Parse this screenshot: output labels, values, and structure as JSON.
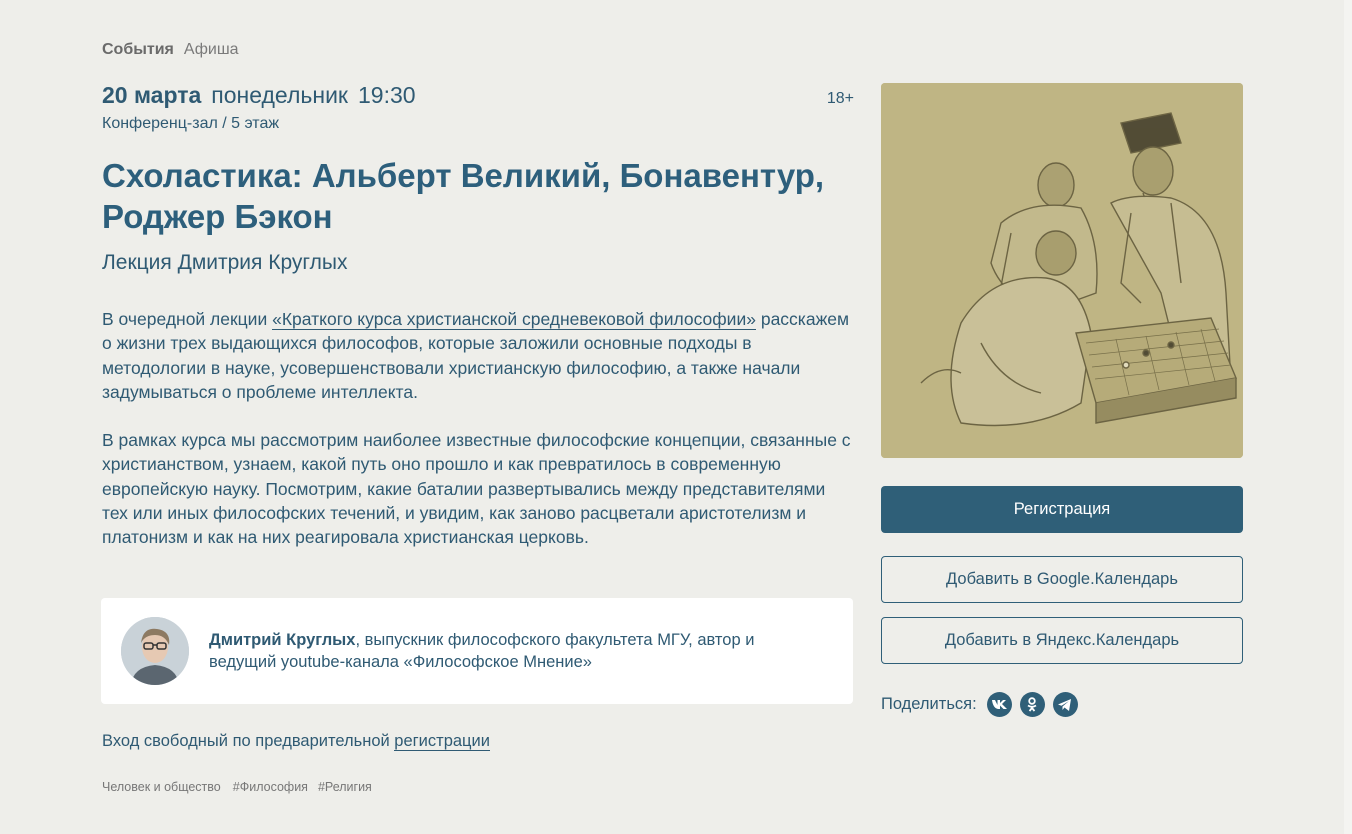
{
  "breadcrumb": {
    "events": "События",
    "afisha": "Афиша"
  },
  "event": {
    "date_day": "20 марта",
    "weekday": "понедельник",
    "time": "19:30",
    "age": "18+",
    "venue": "Конференц-зал / 5 этаж",
    "title": "Схоластика: Альберт Великий, Бонавентур, Роджер Бэкон",
    "subtitle": "Лекция Дмитрия Круглых"
  },
  "description": {
    "p1_prefix": "В очередной лекции ",
    "p1_link": "«Краткого курса христианской средневековой философии»",
    "p1_suffix": " расскажем о жизни трех выдающихся философов, которые заложили основные подходы в методологии в науке, усовершенствовали христианскую философию, а также начали задумываться о проблеме интеллекта.",
    "p2": "В рамках курса мы рассмотрим наиболее известные философские концепции, связанные с христианством, узнаем, какой путь оно прошло и как превратилось в современную европейскую науку. Посмотрим, какие баталии развертывались между представителями тех или иных философских течений, и увидим, как заново расцветали аристотелизм и платонизм и как на них реагировала христианская церковь."
  },
  "speaker": {
    "name": "Дмитрий Круглых",
    "bio": ", выпускник философского факультета МГУ, автор и ведущий youtube-канала «Философское Мнение»"
  },
  "free_entry": {
    "prefix": "Вход свободный по предварительной ",
    "link": "регистрации"
  },
  "tags": [
    "Человек и общество",
    "#Философия",
    "#Религия"
  ],
  "actions": {
    "register": "Регистрация",
    "google_calendar": "Добавить в Google.Календарь",
    "yandex_calendar": "Добавить в Яндекс.Календарь"
  },
  "share": {
    "label": "Поделиться:",
    "networks": [
      "vk-icon",
      "odnoklassniki-icon",
      "telegram-icon"
    ]
  },
  "colors": {
    "background": "#eeeeea",
    "accent": "#2f5f78",
    "poster_tint": "#bfb584"
  }
}
